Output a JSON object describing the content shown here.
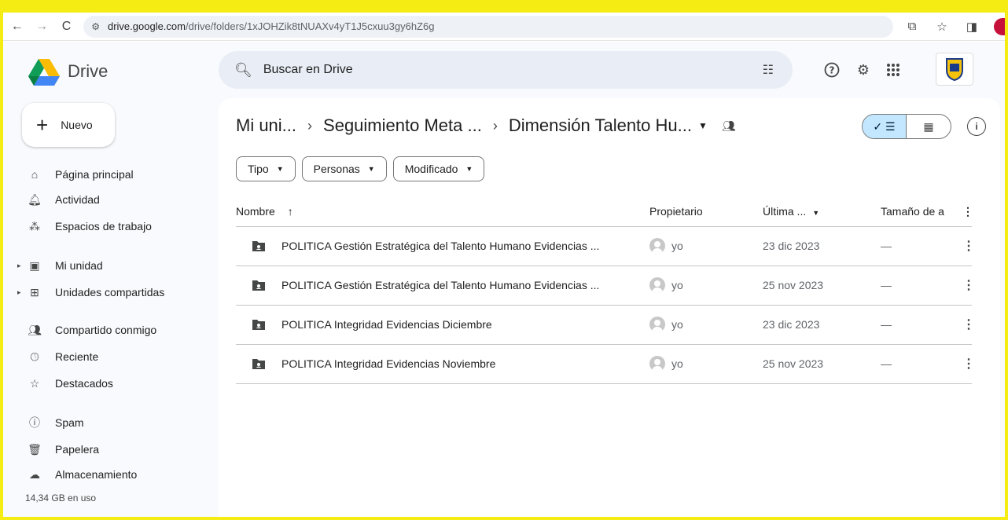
{
  "browser": {
    "url_host": "drive.google.com",
    "url_path": "/drive/folders/1xJOHZik8tNUAXv4yT1J5cxuu3gy6hZ6g"
  },
  "app": {
    "name": "Drive",
    "search_placeholder": "Buscar en Drive",
    "new_label": "Nuevo"
  },
  "sidebar": {
    "items": [
      {
        "label": "Página principal",
        "icon": "home-icon"
      },
      {
        "label": "Actividad",
        "icon": "bell-icon"
      },
      {
        "label": "Espacios de trabajo",
        "icon": "workspaces-icon"
      },
      {
        "label": "Mi unidad",
        "icon": "my-drive-icon"
      },
      {
        "label": "Unidades compartidas",
        "icon": "shared-drives-icon"
      },
      {
        "label": "Compartido conmigo",
        "icon": "people-icon"
      },
      {
        "label": "Reciente",
        "icon": "clock-icon"
      },
      {
        "label": "Destacados",
        "icon": "star-icon"
      },
      {
        "label": "Spam",
        "icon": "spam-icon"
      },
      {
        "label": "Papelera",
        "icon": "trash-icon"
      },
      {
        "label": "Almacenamiento",
        "icon": "cloud-icon"
      }
    ],
    "storage_text": "14,34 GB en uso"
  },
  "breadcrumb": {
    "items": [
      "Mi uni...",
      "Seguimiento Meta ...",
      "Dimensión Talento Hu..."
    ]
  },
  "filters": {
    "chips": [
      "Tipo",
      "Personas",
      "Modificado"
    ]
  },
  "table": {
    "headers": {
      "name": "Nombre",
      "owner": "Propietario",
      "modified": "Última ...",
      "size": "Tamaño de a"
    },
    "rows": [
      {
        "name": "POLITICA Gestión Estratégica del Talento Humano Evidencias ...",
        "owner": "yo",
        "modified": "23 dic 2023",
        "size": "—"
      },
      {
        "name": "POLITICA Gestión Estratégica del Talento Humano Evidencias ...",
        "owner": "yo",
        "modified": "25 nov 2023",
        "size": "—"
      },
      {
        "name": "POLITICA Integridad Evidencias Diciembre",
        "owner": "yo",
        "modified": "23 dic 2023",
        "size": "—"
      },
      {
        "name": "POLITICA Integridad Evidencias Noviembre",
        "owner": "yo",
        "modified": "25 nov 2023",
        "size": "—"
      }
    ]
  },
  "colors": {
    "frame": "#f5ec13",
    "accent": "#c2e7ff",
    "search_bg": "#e9eef6"
  }
}
